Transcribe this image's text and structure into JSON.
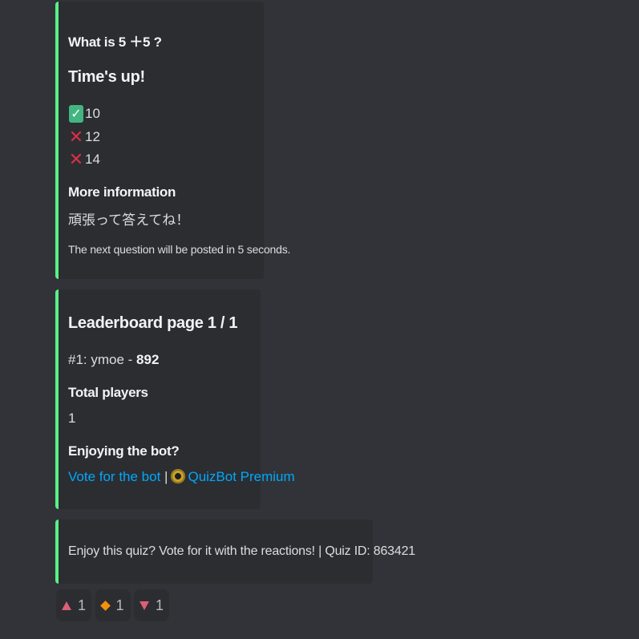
{
  "question_embed": {
    "question": "What is 5 ＋5 ?",
    "status": "Time's up!",
    "answers": [
      {
        "text": "10",
        "correct": true
      },
      {
        "text": "12",
        "correct": false
      },
      {
        "text": "14",
        "correct": false
      }
    ],
    "info_title": "More information",
    "info_value": "頑張って答えてね！",
    "next_text": "The next question will be posted in 5 seconds."
  },
  "leaderboard_embed": {
    "title": "Leaderboard page 1 / 1",
    "entry_prefix": "#1: ymoe - ",
    "entry_score": "892",
    "total_title": "Total players",
    "total_value": "1",
    "enjoy_title": "Enjoying the bot?",
    "vote_link": "Vote for the bot",
    "separator": "|",
    "premium_link": "QuizBot Premium"
  },
  "footer_embed": {
    "text": "Enjoy this quiz? Vote for it with the reactions! | Quiz ID: 863421"
  },
  "reactions": [
    {
      "icon": "upvote-triangle-icon",
      "count": "1"
    },
    {
      "icon": "orange-diamond-icon",
      "count": "1"
    },
    {
      "icon": "downvote-triangle-icon",
      "count": "1"
    }
  ],
  "colors": {
    "background": "#313338",
    "embed_bg": "#2b2d31",
    "embed_accent": "#57f287",
    "link": "#00a8fc"
  }
}
